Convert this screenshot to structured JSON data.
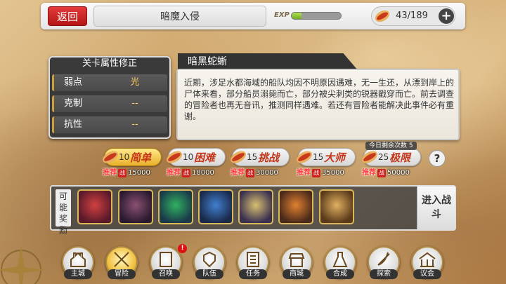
{
  "header": {
    "back_label": "返回",
    "stage_name": "暗魔入侵",
    "exp_label": "EXP",
    "exp_progress": 0.2,
    "stamina_text": "43/189",
    "plus_label": "+"
  },
  "modifiers": {
    "title": "关卡属性修正",
    "rows": [
      {
        "key": "弱点",
        "value": "光"
      },
      {
        "key": "克制",
        "value": "--"
      },
      {
        "key": "抗性",
        "value": "--"
      }
    ]
  },
  "description": {
    "title": "暗黑蛇蜥",
    "text": "近期，涉足水都海域的船队均因不明原因遇难，无一生还，从漂到岸上的尸体来看，部分船员溺毙而亡，部分被尖刺类的锐器戳穿而亡。前去调查的冒险者也再无音讯，推测同样遇难。若还有冒险者能解决此事件必有重谢。"
  },
  "difficulties": [
    {
      "cost": "10",
      "name": "简单",
      "rec_label": "推荐",
      "zhan": "战",
      "power": "15000",
      "selected": true
    },
    {
      "cost": "10",
      "name": "困难",
      "rec_label": "推荐",
      "zhan": "战",
      "power": "18000",
      "selected": false
    },
    {
      "cost": "15",
      "name": "挑战",
      "rec_label": "推荐",
      "zhan": "战",
      "power": "30000",
      "selected": false
    },
    {
      "cost": "15",
      "name": "大师",
      "rec_label": "推荐",
      "zhan": "战",
      "power": "35000",
      "selected": false
    },
    {
      "cost": "25",
      "name": "极限",
      "rec_label": "推荐",
      "zhan": "战",
      "power": "50000",
      "selected": false
    }
  ],
  "remaining": "今日剩余次数 5",
  "help_label": "?",
  "rewards": {
    "label": "可能奖励",
    "items": [
      {
        "icon": "red-haired-hero-portrait",
        "colors": [
          "#5a1a2a",
          "#d04040"
        ]
      },
      {
        "icon": "dark-demon-portrait",
        "colors": [
          "#2a1a30",
          "#8a5070"
        ]
      },
      {
        "icon": "green-crystal-icon",
        "colors": [
          "#1a3a4a",
          "#30b060"
        ]
      },
      {
        "icon": "blue-crystal-icon",
        "colors": [
          "#1a2a4a",
          "#4080d0"
        ]
      },
      {
        "icon": "blonde-hero-portrait",
        "colors": [
          "#3a3050",
          "#d8c070"
        ]
      },
      {
        "icon": "orange-gem-icon",
        "colors": [
          "#4a2a1a",
          "#e08030"
        ]
      },
      {
        "icon": "potion-jar-icon",
        "colors": [
          "#5a3a1a",
          "#e0b060"
        ]
      }
    ]
  },
  "enter_label": "进入战斗",
  "nav": {
    "badge": "!",
    "items": [
      {
        "label": "主城",
        "icon": "castle-icon",
        "selected": false
      },
      {
        "label": "冒险",
        "icon": "crossed-swords-icon",
        "selected": true
      },
      {
        "label": "召唤",
        "icon": "summon-card-icon",
        "selected": false
      },
      {
        "label": "队伍",
        "icon": "winged-shield-icon",
        "selected": false
      },
      {
        "label": "任务",
        "icon": "quest-book-icon",
        "selected": false
      },
      {
        "label": "商城",
        "icon": "shop-stall-icon",
        "selected": false
      },
      {
        "label": "合成",
        "icon": "alchemy-flask-icon",
        "selected": false
      },
      {
        "label": "探索",
        "icon": "compass-bow-icon",
        "selected": false
      },
      {
        "label": "议会",
        "icon": "council-hall-icon",
        "selected": false
      }
    ]
  }
}
